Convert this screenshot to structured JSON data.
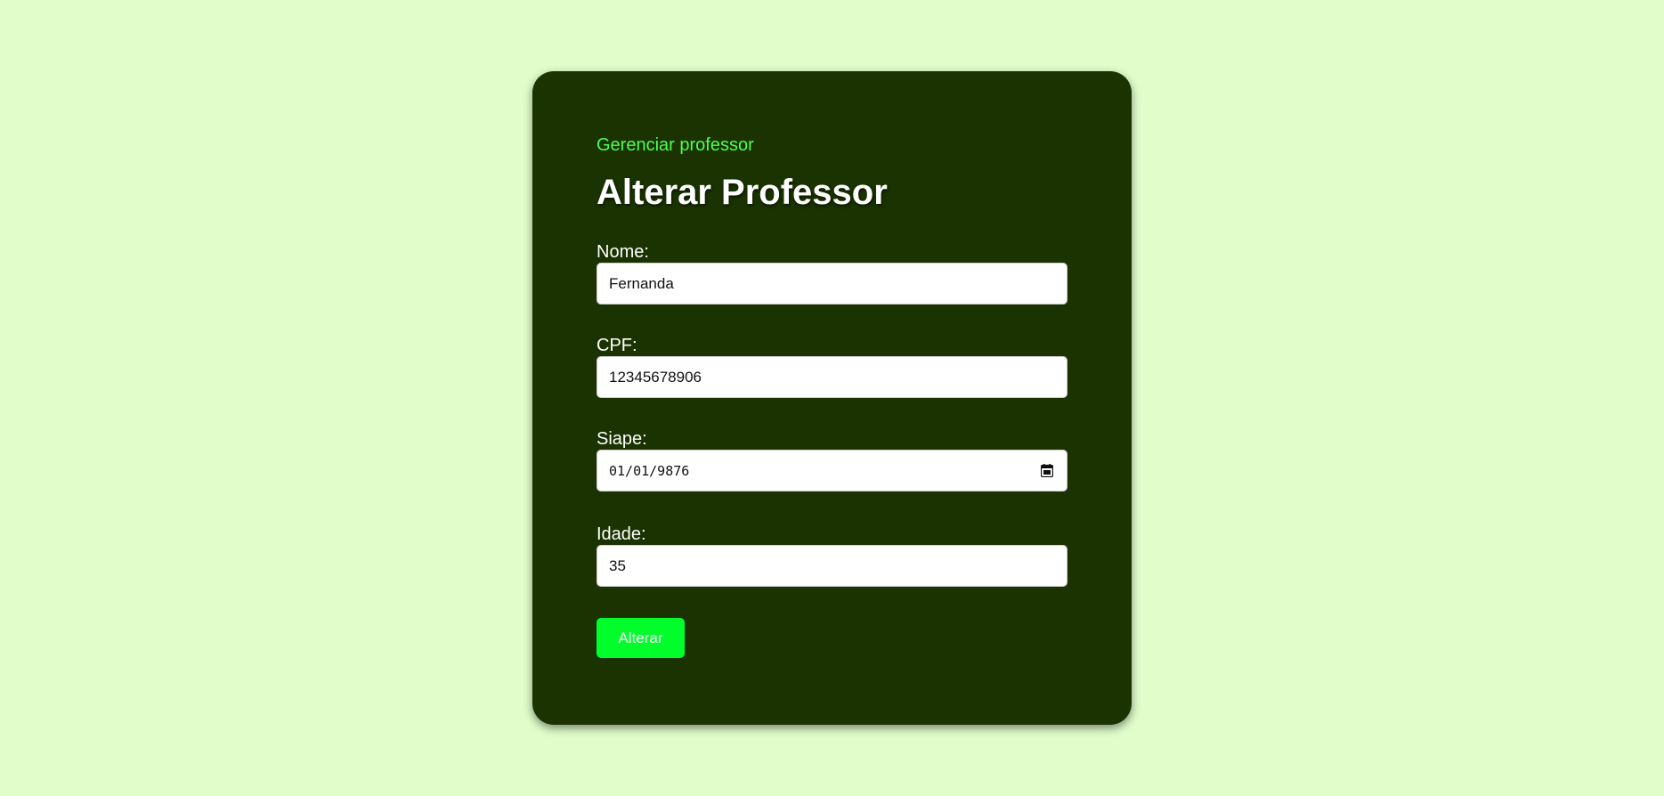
{
  "header": {
    "breadcrumb": "Gerenciar professor",
    "title": "Alterar Professor"
  },
  "form": {
    "fields": [
      {
        "label": "Nome:",
        "value": "Fernanda"
      },
      {
        "label": "CPF:",
        "value": "12345678906"
      },
      {
        "label": "Siape:",
        "value": "01/01/9876"
      },
      {
        "label": "Idade:",
        "value": "35"
      }
    ],
    "submit_label": "Alterar"
  },
  "icons": {
    "date_picker": "calendar-icon"
  },
  "colors": {
    "background": "#e0fdca",
    "card": "#1a3300",
    "link": "#4dff4d",
    "button": "#00ff2a"
  }
}
